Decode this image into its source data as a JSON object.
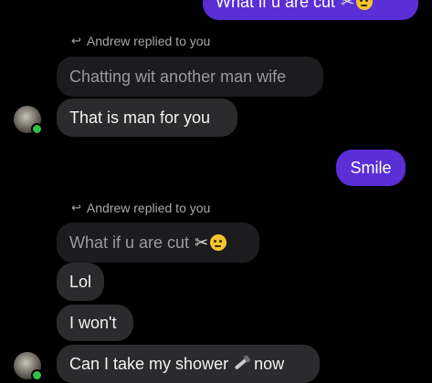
{
  "messages": {
    "top_outgoing": {
      "text": "What if u are cut"
    },
    "reply1_label": "Andrew replied to you",
    "reply1_quote": "Chatting wit another man wife",
    "reply1_text": "That is man for you",
    "smile_outgoing": "Smile",
    "reply2_label": "Andrew replied to you",
    "reply2_quote": "What if u are cut",
    "lol": "Lol",
    "wont": "I won't",
    "shower_part1": "Can I take my shower",
    "shower_part2": "now"
  },
  "icons": {
    "reply_arrow": "reply-arrow-icon",
    "scissors": "scissors-icon",
    "thinking": "thinking-face-icon",
    "shower": "bathtub-icon"
  },
  "colors": {
    "background": "#000000",
    "incoming_bubble": "#2b2b2d",
    "quoted_bubble": "#1c1c1e",
    "outgoing_bubble": "#5a2fd6",
    "online": "#31c24d"
  }
}
